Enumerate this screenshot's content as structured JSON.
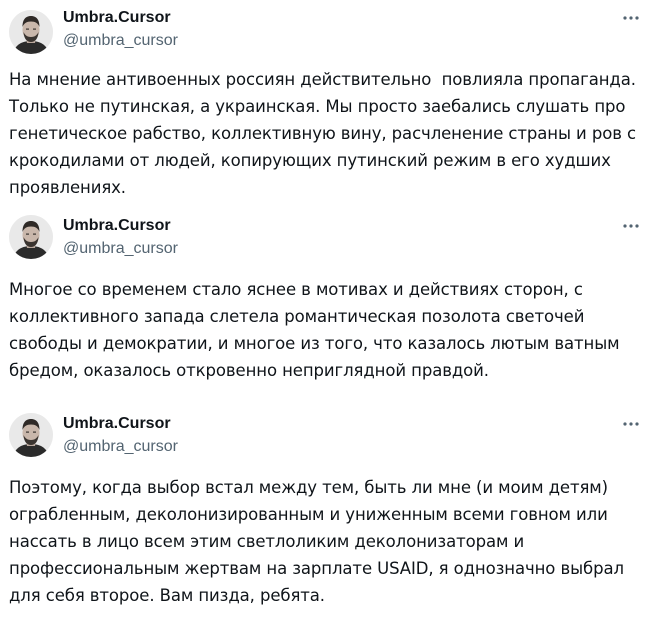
{
  "tweets": [
    {
      "author": {
        "name": "Umbra.Cursor",
        "handle": "@umbra_cursor"
      },
      "more_icon": "more-horizontal-icon",
      "text": "На мнение антивоенных россиян действительно  повлияла пропаганда.\nТолько не путинская, а украинская. Мы просто заебались слушать про\nгенетическое рабство, коллективную вину, расчленение страны и ров с\nкрокодилами от людей, копирующих путинский режим в его худших\nпроявлениях."
    },
    {
      "author": {
        "name": "Umbra.Cursor",
        "handle": "@umbra_cursor"
      },
      "more_icon": "more-horizontal-icon",
      "text": "Многое со временем стало яснее в мотивах и действиях сторон, с\nколлективного запада слетела романтическая позолота светочей\nсвободы и демократии, и многое из того, что казалось лютым ватным\nбредом, оказалось откровенно неприглядной правдой."
    },
    {
      "author": {
        "name": "Umbra.Cursor",
        "handle": "@umbra_cursor"
      },
      "more_icon": "more-horizontal-icon",
      "text": "Поэтому, когда выбор встал между тем, быть ли мне (и моим детям)\nограбленным, деколонизированным и униженным всеми говном или\nнассать в лицо всем этим светлоликим деколонизаторам и\nпрофессиональным жертвам на зарплате USAID, я однозначно выбрал\nдля себя второе. Вам пизда, ребята."
    }
  ],
  "colors": {
    "text": "#0f1419",
    "secondary": "#536471",
    "background": "#ffffff"
  }
}
